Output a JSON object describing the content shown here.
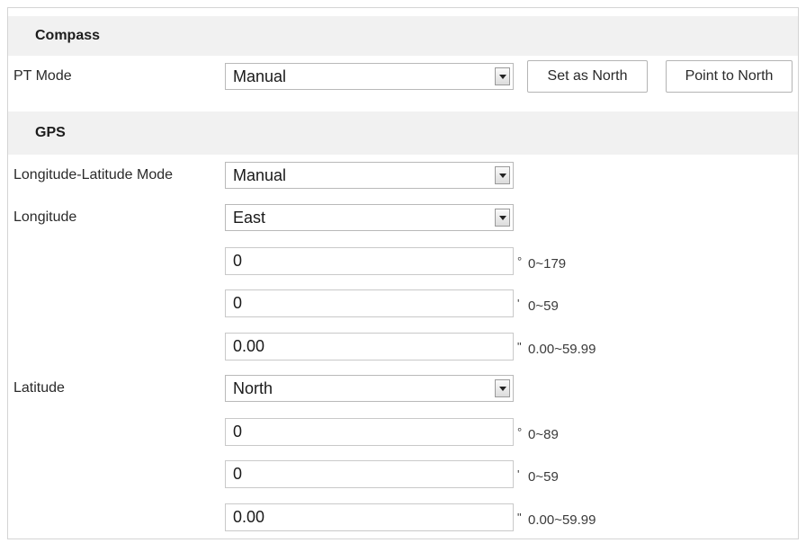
{
  "compass": {
    "header": "Compass",
    "pt_mode_label": "PT Mode",
    "pt_mode_value": "Manual",
    "set_as_north_label": "Set as North",
    "point_to_north_label": "Point to North"
  },
  "gps": {
    "header": "GPS",
    "mode_label": "Longitude-Latitude Mode",
    "mode_value": "Manual",
    "longitude": {
      "label": "Longitude",
      "direction": "East",
      "degrees": {
        "value": "0",
        "symbol": "°",
        "range": "0~179"
      },
      "minutes": {
        "value": "0",
        "symbol": "'",
        "range": "0~59"
      },
      "seconds": {
        "value": "0.00",
        "symbol": "\"",
        "range": "0.00~59.99"
      }
    },
    "latitude": {
      "label": "Latitude",
      "direction": "North",
      "degrees": {
        "value": "0",
        "symbol": "°",
        "range": "0~89"
      },
      "minutes": {
        "value": "0",
        "symbol": "'",
        "range": "0~59"
      },
      "seconds": {
        "value": "0.00",
        "symbol": "\"",
        "range": "0.00~59.99"
      }
    }
  }
}
